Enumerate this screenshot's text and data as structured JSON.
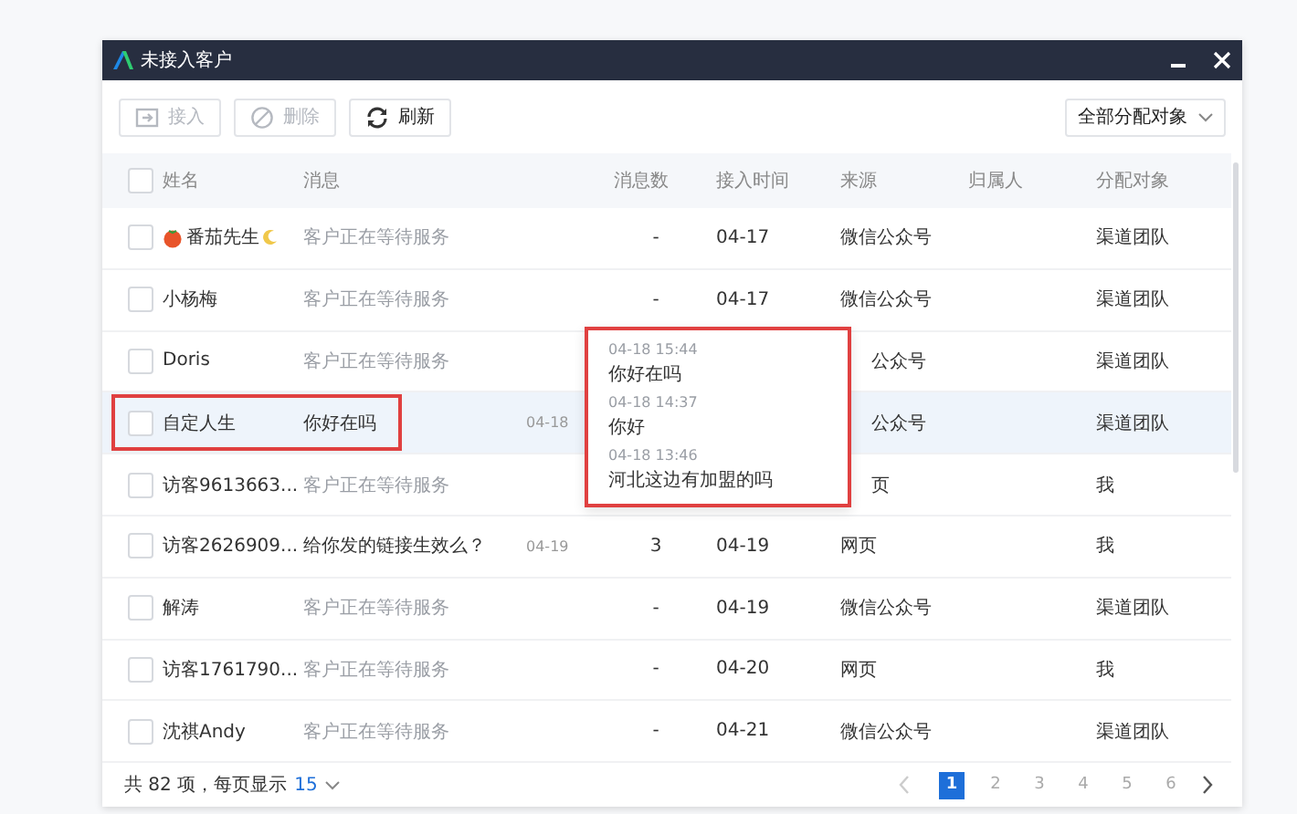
{
  "window": {
    "title": "未接入客户"
  },
  "toolbar": {
    "buttons": [
      {
        "label": "接入",
        "disabled": true
      },
      {
        "label": "删除",
        "disabled": true
      },
      {
        "label": "刷新",
        "disabled": false
      }
    ],
    "filter": {
      "value": "全部分配对象"
    }
  },
  "table": {
    "all_checked": false,
    "columns": [
      "姓名",
      "消息",
      "消息数",
      "接入时间",
      "来源",
      "归属人",
      "分配对象"
    ],
    "rows": [
      {
        "checked": false,
        "name": "番茄先生",
        "decorated": true,
        "message": "客户正在等待服务",
        "kind": "waiting",
        "count": "-",
        "time": "04-17",
        "source": "微信公众号",
        "assignee": "渠道团队",
        "highlighted": false,
        "outlined": false
      },
      {
        "checked": false,
        "name": "小杨梅",
        "decorated": false,
        "message": "客户正在等待服务",
        "kind": "waiting",
        "count": "-",
        "time": "04-17",
        "source": "微信公众号",
        "assignee": "渠道团队",
        "highlighted": false,
        "outlined": false
      },
      {
        "checked": false,
        "name": "Doris",
        "decorated": false,
        "message": "客户正在等待服务",
        "kind": "waiting",
        "source": "公众号",
        "source_covered": true,
        "assignee": "渠道团队",
        "highlighted": false,
        "outlined": false
      },
      {
        "checked": false,
        "name": "自定人生",
        "decorated": false,
        "message": "你好在吗",
        "kind": "message",
        "message_time": "04-18",
        "source": "公众号",
        "source_covered": true,
        "assignee": "渠道团队",
        "highlighted": true,
        "outlined": true
      },
      {
        "checked": false,
        "name": "访客9613663...",
        "decorated": false,
        "message": "客户正在等待服务",
        "kind": "waiting",
        "source": "页",
        "source_covered": true,
        "assignee": "我",
        "highlighted": false,
        "outlined": false
      },
      {
        "checked": false,
        "name": "访客2626909...",
        "decorated": false,
        "message": "给你发的链接生效么？",
        "kind": "message",
        "message_time": "04-19",
        "count": "3",
        "time": "04-19",
        "source": "网页",
        "assignee": "我",
        "highlighted": false,
        "outlined": false
      },
      {
        "checked": false,
        "name": "解涛",
        "decorated": false,
        "message": "客户正在等待服务",
        "kind": "waiting",
        "count": "-",
        "time": "04-19",
        "source": "微信公众号",
        "assignee": "渠道团队",
        "highlighted": false,
        "outlined": false
      },
      {
        "checked": false,
        "name": "访客1761790...",
        "decorated": false,
        "message": "客户正在等待服务",
        "kind": "waiting",
        "count": "-",
        "time": "04-20",
        "source": "网页",
        "assignee": "我",
        "highlighted": false,
        "outlined": false
      },
      {
        "checked": false,
        "name": "沈祺Andy",
        "decorated": false,
        "message": "客户正在等待服务",
        "kind": "waiting",
        "count": "-",
        "time": "04-21",
        "source": "微信公众号",
        "assignee": "渠道团队",
        "highlighted": false,
        "outlined": false
      }
    ]
  },
  "popup": {
    "messages": [
      {
        "time": "04-18 15:44",
        "text": "你好在吗"
      },
      {
        "time": "04-18 14:37",
        "text": "你好"
      },
      {
        "time": "04-18 13:46",
        "text": "河北这边有加盟的吗"
      }
    ]
  },
  "footer": {
    "summary": "共 82 项，每页显示",
    "page_size": "15",
    "pages": [
      {
        "label": "1",
        "selected": true
      },
      {
        "label": "2",
        "selected": false
      },
      {
        "label": "3",
        "selected": false
      },
      {
        "label": "4",
        "selected": false
      },
      {
        "label": "5",
        "selected": false
      },
      {
        "label": "6",
        "selected": false
      }
    ],
    "prev_disabled": true,
    "next_disabled": false
  }
}
